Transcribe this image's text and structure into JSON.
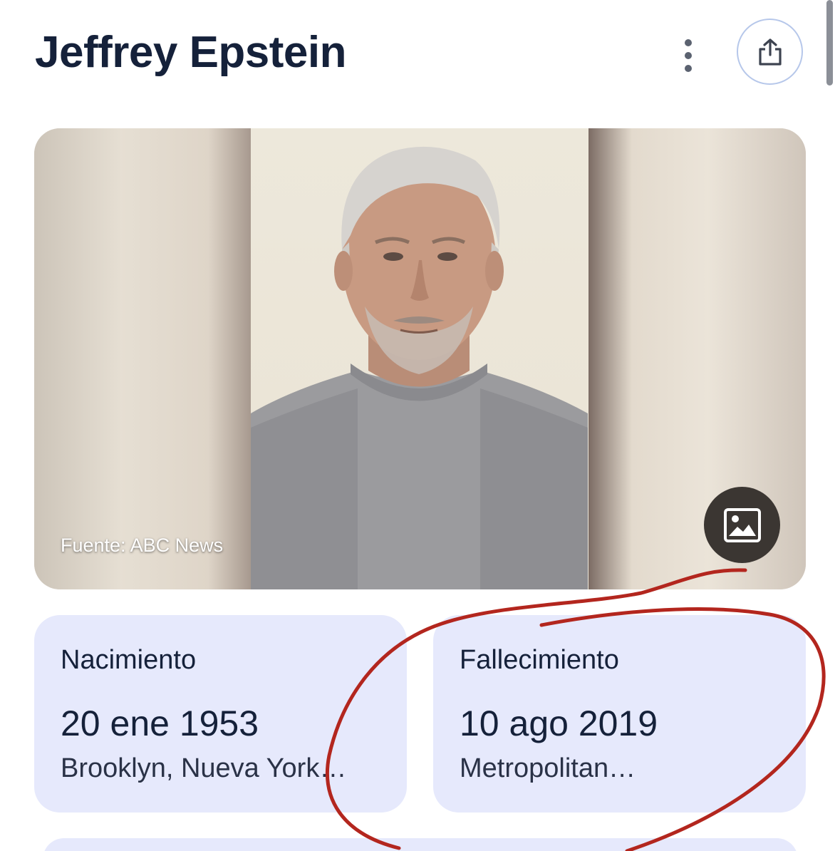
{
  "header": {
    "title": "Jeffrey Epstein",
    "more_icon": "more-vertical-icon",
    "share_icon": "share-icon"
  },
  "image_card": {
    "source_label": "Fuente: ABC News",
    "image_icon": "image-icon"
  },
  "facts": [
    {
      "label": "Nacimiento",
      "date": "20 ene 1953",
      "place": "Brooklyn, Nueva York…"
    },
    {
      "label": "Fallecimiento",
      "date": "10 ago 2019",
      "place": "Metropolitan…"
    }
  ],
  "colors": {
    "title": "#15213a",
    "card_background": "#e6e9fc",
    "share_border": "#b6c7ea",
    "annotation_red": "#b3261e"
  }
}
